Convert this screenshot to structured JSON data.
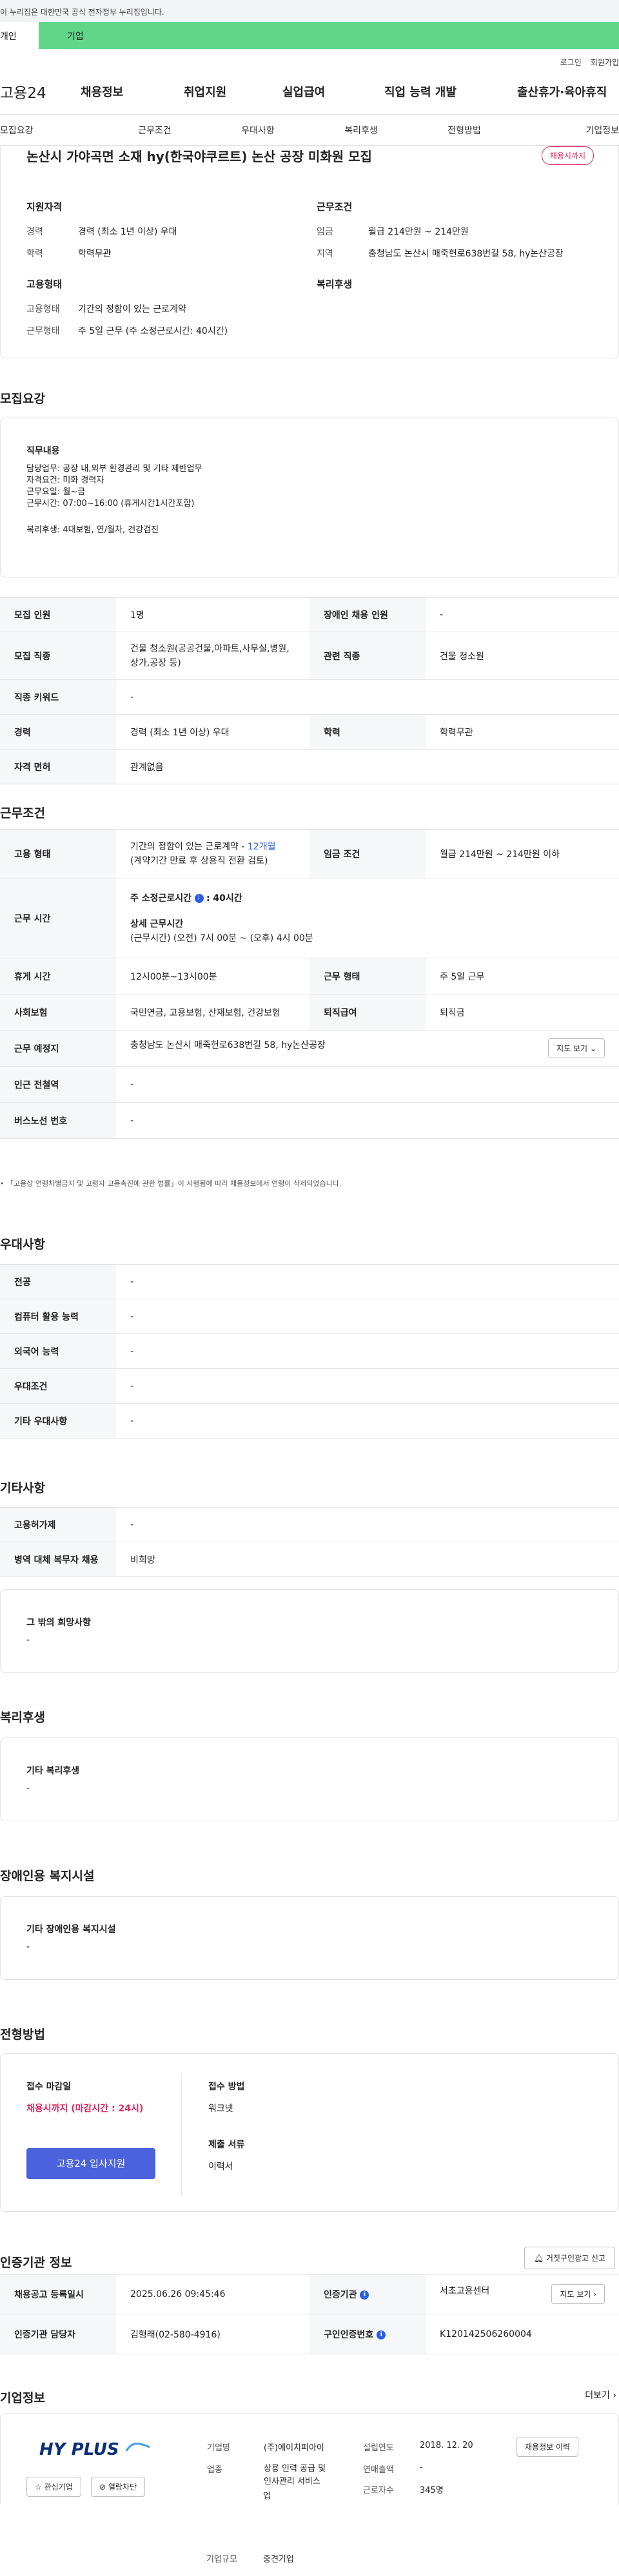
{
  "gov_banner": "이 누리집은 대한민국 공식 전자정부 누리집입니다.",
  "tabs": {
    "personal": "개인",
    "business": "기업"
  },
  "util": {
    "login": "로그인",
    "signup": "회원가입"
  },
  "logo": "고용24",
  "gnb": [
    "채용정보",
    "취업지원",
    "실업급여",
    "직업 능력 개발",
    "출산휴가·육아휴직"
  ],
  "subnav": [
    "모집요강",
    "근무조건",
    "우대사항",
    "복리후생",
    "전형방법",
    "기업정보"
  ],
  "summary": {
    "title": "논산시 가야곡면 소재 hy(한국야쿠르트) 논산 공장 미화원 모집",
    "badge": "채용시까지",
    "qual_title": "지원자격",
    "qual": [
      {
        "k": "경력",
        "v": "경력 (최소 1년 이상) 우대"
      },
      {
        "k": "학력",
        "v": "학력무관"
      }
    ],
    "cond_title": "근무조건",
    "cond": [
      {
        "k": "임금",
        "v": "월급 214만원 ~ 214만원"
      },
      {
        "k": "지역",
        "v": "충청남도 논산시 매죽헌로638번길 58, hy논산공장"
      }
    ],
    "emp_title": "고용형태",
    "emp": [
      {
        "k": "고용형태",
        "v": "기간의 정함이 있는 근로계약"
      },
      {
        "k": "근무형태",
        "v": "주 5일 근무 (주 소정근로시간: 40시간)"
      }
    ],
    "welfare_title": "복리후생"
  },
  "recruit": {
    "title": "모집요강",
    "duty_title": "직무내용",
    "duty_lines": [
      "담당업무: 공장 내,외부 환경관리 및 기타 제반업무",
      "자격요건: 미화 경력자",
      "근무요일: 월~금",
      "근무시간: 07:00~16:00 (휴게시간1시간포함)"
    ],
    "duty_welfare": "복리후생: 4대보험, 연/월차, 건강검진",
    "rows": {
      "count_k": "모집 인원",
      "count_v": "1명",
      "disabled_k": "장애인 채용 인원",
      "disabled_v": "-",
      "job_k": "모집 직종",
      "job_v1": "건물 청소원(공공건물,아파트,사무실,병원,",
      "job_v2": "상가,공장 등)",
      "rel_k": "관련 직종",
      "rel_v": "건물 청소원",
      "kw_k": "직종 키워드",
      "kw_v": "-",
      "career_k": "경력",
      "career_v": "경력 (최소 1년 이상) 우대",
      "edu_k": "학력",
      "edu_v": "학력무관",
      "license_k": "자격 면허",
      "license_v": "관계없음"
    }
  },
  "work": {
    "title": "근무조건",
    "emp_k": "고용 형태",
    "emp_v1": "기간의 정함이 있는 근로계약 - ",
    "emp_months": "12개월",
    "emp_v2": "(계약기간 만료 후 상용직 전환 검토)",
    "wage_k": "임금 조건",
    "wage_v": "월급 214만원 ~ 214만원 이하",
    "time_k": "근무 시간",
    "time_weekly_label": "주 소정근로시간",
    "time_weekly_v": ": 40시간",
    "time_detail_label": "상세 근무시간",
    "time_detail_v": "(근무시간) (오전) 7시 00분 ~ (오후) 4시 00분",
    "rest_k": "휴게 시간",
    "rest_v": "12시00분~13시00분",
    "shape_k": "근무 형태",
    "shape_v": "주 5일 근무",
    "ins_k": "사회보험",
    "ins_v": "국민연금, 고용보험, 산재보험, 건강보험",
    "ret_k": "퇴직급여",
    "ret_v": "퇴직금",
    "place_k": "근무 예정지",
    "place_v": "충청남도 논산시 매죽헌로638번길 58, hy논산공장",
    "map_btn": "지도 보기",
    "subway_k": "인근 전철역",
    "subway_v": "-",
    "bus_k": "버스노선 번호",
    "bus_v": "-",
    "note": "「고용상 연령차별금지 및 고령자 고용촉진에 관한 법률」이 시행됨에 따라 채용정보에서 연령이 삭제되었습니다."
  },
  "pref": {
    "title": "우대사항",
    "rows": [
      {
        "k": "전공",
        "v": "-"
      },
      {
        "k": "컴퓨터 활용 능력",
        "v": "-"
      },
      {
        "k": "외국어 능력",
        "v": "-"
      },
      {
        "k": "우대조건",
        "v": "-"
      },
      {
        "k": "기타 우대사항",
        "v": "-"
      }
    ]
  },
  "etc": {
    "title": "기타사항",
    "rows": [
      {
        "k": "고용허가제",
        "v": "-"
      },
      {
        "k": "병역 대체 복무자 채용",
        "v": "비희망"
      }
    ],
    "hope_title": "그 밖의 희망사항",
    "hope_v": "-"
  },
  "welfare": {
    "title": "복리후생",
    "box_title": "기타 복리후생",
    "box_v": "-"
  },
  "disabled": {
    "title": "장애인용 복지시설",
    "box_title": "기타 장애인용 복지시설",
    "box_v": "-"
  },
  "screen": {
    "title": "전형방법",
    "deadline_title": "접수 마감일",
    "deadline_v": "채용시까지 (마감시간 : 24시)",
    "apply_btn": "고용24 입사지원",
    "method_title": "접수 방법",
    "method_v": "워크넷",
    "docs_title": "제출 서류",
    "docs_v": "이력서"
  },
  "cert": {
    "title": "인증기관 정보",
    "report_btn": "거짓구인광고 신고",
    "reg_k": "채용공고 등록일시",
    "reg_v": "2025.06.26 09:45:46",
    "org_k": "인증기관",
    "org_v": "서초고용센터",
    "map_btn": "지도 보기",
    "mgr_k": "인증기관 담당자",
    "mgr_v": "김형래(02-580-4916)",
    "num_k": "구인인증번호",
    "num_v": "K120142506260004"
  },
  "company": {
    "title": "기업정보",
    "more": "더보기",
    "logo_text": "HY PLUS",
    "fav_btn": "관심기업",
    "block_btn": "열람차단",
    "name_k": "기업명",
    "name_v": "(주)에이치피아이",
    "found_k": "설립연도",
    "found_v": "2018. 12. 20",
    "jobs_btn": "채용정보 이력",
    "biz_k": "업종",
    "biz_v1": "상용 인력 공급 및",
    "biz_v2": "인사관리 서비스",
    "biz_v3": "업",
    "sales_k": "연매출액",
    "sales_v": "-",
    "emp_k": "근로자수",
    "emp_v": "345명",
    "size_k": "기업규모",
    "size_v": "중견기업"
  },
  "colors": {
    "green": "#5fd68a",
    "blue": "#2b5ce6",
    "red": "#e0245e",
    "btn_blue": "#4a62dc"
  }
}
